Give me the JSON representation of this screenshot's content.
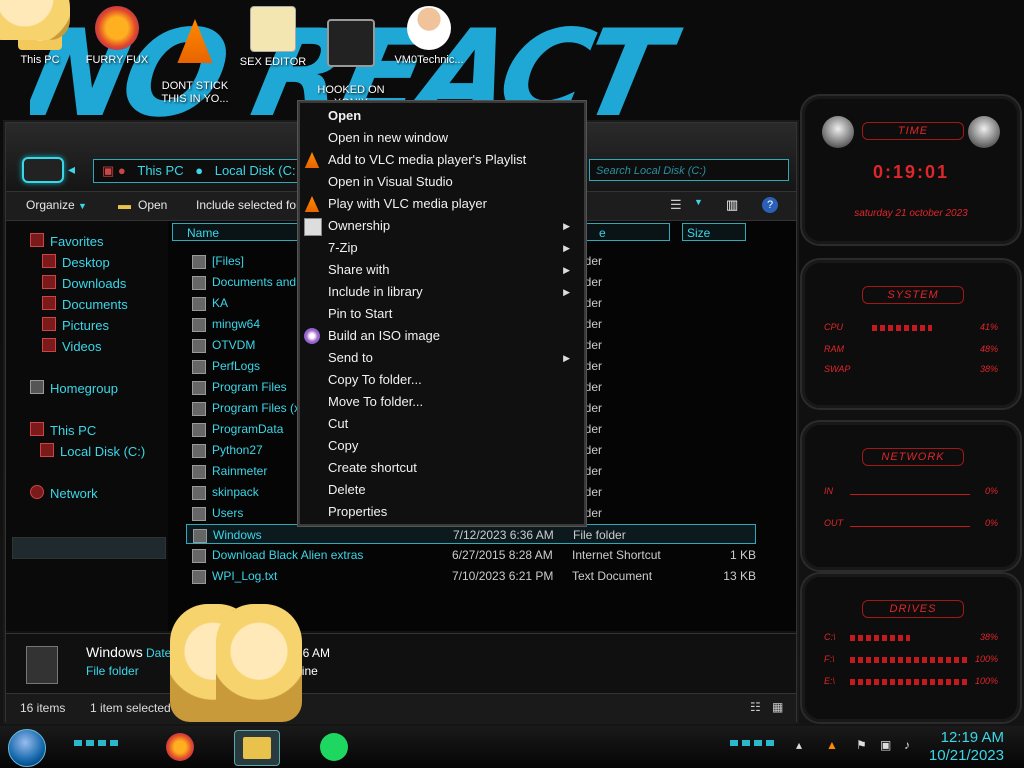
{
  "desktop": {
    "icons": [
      {
        "label": "This PC"
      },
      {
        "label": "FURRY FUX"
      },
      {
        "label": "DONT STICK\nTHIS IN YO..."
      },
      {
        "label": "SEX EDITOR"
      },
      {
        "label": "HOOKED ON\nXONIX"
      },
      {
        "label": "VM0Technic..."
      }
    ],
    "wallpaper_text": "NO REACT"
  },
  "explorer": {
    "address": {
      "seg1": "This PC",
      "seg2": "Local Disk (C:"
    },
    "search_placeholder": "Search Local Disk (C:)",
    "toolbar": {
      "organize": "Organize",
      "open": "Open",
      "include": "Include selected fol"
    },
    "nav": {
      "favorites": "Favorites",
      "desktop": "Desktop",
      "downloads": "Downloads",
      "documents": "Documents",
      "pictures": "Pictures",
      "videos": "Videos",
      "homegroup": "Homegroup",
      "this_pc": "This PC",
      "local_disk": "Local Disk (C:)",
      "network": "Network"
    },
    "columns": {
      "name": "Name",
      "type": "e",
      "size": "Size"
    },
    "files": [
      {
        "name": "[Files]",
        "date": "",
        "type": "folder",
        "size": ""
      },
      {
        "name": "Documents and Se",
        "date": "",
        "type": "folder",
        "size": ""
      },
      {
        "name": "KA",
        "date": "",
        "type": "folder",
        "size": ""
      },
      {
        "name": "mingw64",
        "date": "",
        "type": "folder",
        "size": ""
      },
      {
        "name": "OTVDM",
        "date": "",
        "type": "folder",
        "size": ""
      },
      {
        "name": "PerfLogs",
        "date": "",
        "type": "folder",
        "size": ""
      },
      {
        "name": "Program Files",
        "date": "",
        "type": "folder",
        "size": ""
      },
      {
        "name": "Program Files (x8",
        "date": "",
        "type": "folder",
        "size": ""
      },
      {
        "name": "ProgramData",
        "date": "",
        "type": "folder",
        "size": ""
      },
      {
        "name": "Python27",
        "date": "",
        "type": "folder",
        "size": ""
      },
      {
        "name": "Rainmeter",
        "date": "",
        "type": "folder",
        "size": ""
      },
      {
        "name": "skinpack",
        "date": "",
        "type": "folder",
        "size": ""
      },
      {
        "name": "Users",
        "date": "",
        "type": "folder",
        "size": ""
      },
      {
        "name": "Windows",
        "date": "7/12/2023 6:36 AM",
        "type": "File folder",
        "size": ""
      },
      {
        "name": "Download Black Alien extras",
        "date": "6/27/2015 8:28 AM",
        "type": "Internet Shortcut",
        "size": "1 KB"
      },
      {
        "name": "WPI_Log.txt",
        "date": "7/10/2023 6:21 PM",
        "type": "Text Document",
        "size": "13 KB"
      }
    ],
    "details": {
      "name": "Windows",
      "date_label": "Date",
      "type": "File folder",
      "time": "6:36 AM",
      "offline": "offline"
    },
    "status": {
      "count": "16 items",
      "selected": "1 item selected"
    }
  },
  "context_menu": [
    {
      "label": "Open",
      "bold": true,
      "arrow": false
    },
    {
      "label": "Open in new window",
      "arrow": false
    },
    {
      "label": "Add to VLC media player's Playlist",
      "arrow": false,
      "icon": "vlc-icon"
    },
    {
      "label": "Open in Visual Studio",
      "arrow": false
    },
    {
      "label": "Play with VLC media player",
      "arrow": false,
      "icon": "vlc-icon"
    },
    {
      "label": "Ownership",
      "arrow": true,
      "icon": "ownership-icon"
    },
    {
      "label": "7-Zip",
      "arrow": true
    },
    {
      "label": "Share with",
      "arrow": true
    },
    {
      "label": "Include in library",
      "arrow": true
    },
    {
      "label": "Pin to Start",
      "arrow": false
    },
    {
      "label": "Build an ISO image",
      "arrow": false,
      "icon": "iso-icon"
    },
    {
      "label": "Send to",
      "arrow": true
    },
    {
      "label": "Copy To folder...",
      "arrow": false
    },
    {
      "label": "Move To folder...",
      "arrow": false
    },
    {
      "label": "Cut",
      "arrow": false
    },
    {
      "label": "Copy",
      "arrow": false
    },
    {
      "label": "Create shortcut",
      "arrow": false
    },
    {
      "label": "Delete",
      "arrow": false
    },
    {
      "label": "Properties",
      "arrow": false
    }
  ],
  "widgets": {
    "time": {
      "title": "TIME",
      "clock": "0:19:01",
      "date": "saturday 21 october 2023"
    },
    "system": {
      "title": "SYSTEM",
      "cpu_label": "CPU",
      "cpu": "41%",
      "ram_label": "RAM",
      "ram": "48%",
      "swap_label": "SWAP",
      "swap": "38%"
    },
    "network": {
      "title": "NETWORK",
      "in_label": "IN",
      "in": "0%",
      "out_label": "OUT",
      "out": "0%"
    },
    "drives": {
      "title": "DRIVES",
      "c_label": "C:\\",
      "c": "38%",
      "f_label": "F:\\",
      "f": "100%",
      "e_label": "E:\\",
      "e": "100%"
    }
  },
  "taskbar": {
    "time": "12:19 AM",
    "date": "10/21/2023"
  },
  "colors": {
    "accent": "#3bd6e8",
    "widget_red": "#e0262a"
  }
}
